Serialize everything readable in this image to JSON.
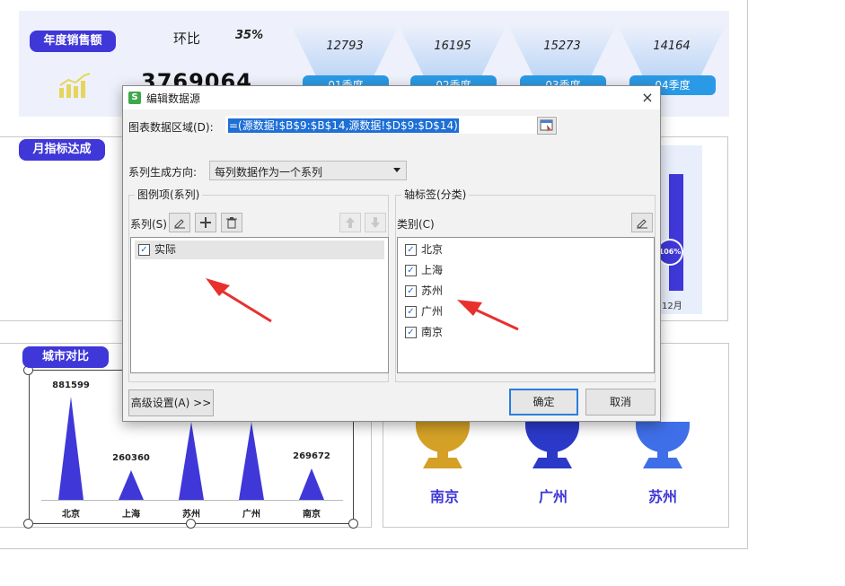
{
  "dashboard": {
    "annual_sales_title": "年度销售额",
    "mom_label": "环比",
    "mom_value": "35%",
    "annual_total": "3769064",
    "quarters": [
      {
        "value": "12793",
        "label": "01季度"
      },
      {
        "value": "16195",
        "label": "02季度"
      },
      {
        "value": "15273",
        "label": "03季度"
      },
      {
        "value": "14164",
        "label": "04季度"
      }
    ],
    "monthly_title": "月指标达成",
    "monthly_badge": "106%",
    "monthly_month": "12月",
    "city_compare_title": "城市对比",
    "city_chart": {
      "categories": [
        "北京",
        "上海",
        "苏州",
        "广州",
        "南京"
      ],
      "values": [
        "881599",
        "260360",
        "",
        "",
        "269672"
      ]
    },
    "ranking": [
      {
        "rank": "1",
        "city": "南京",
        "color": "#d4a126"
      },
      {
        "rank": "2",
        "city": "广州",
        "color": "#2b39c9"
      },
      {
        "rank": "3",
        "city": "苏州",
        "color": "#3f6fe8"
      }
    ]
  },
  "dialog": {
    "title": "编辑数据源",
    "app_icon": "S",
    "close_icon": "×",
    "range_label": "图表数据区域(D):",
    "range_value": "=(源数据!$B$9:$B$14,源数据!$D$9:$D$14)",
    "direction_label": "系列生成方向:",
    "direction_value": "每列数据作为一个系列",
    "legend_group": "图例项(系列)",
    "series_label": "系列(S)",
    "series": [
      {
        "label": "实际",
        "checked": true
      }
    ],
    "axis_group": "轴标签(分类)",
    "category_label": "类别(C)",
    "categories": [
      {
        "label": "北京",
        "checked": true
      },
      {
        "label": "上海",
        "checked": true
      },
      {
        "label": "苏州",
        "checked": true
      },
      {
        "label": "广州",
        "checked": true
      },
      {
        "label": "南京",
        "checked": true
      }
    ],
    "advanced_button": "高级设置(A) >>",
    "ok_button": "确定",
    "cancel_button": "取消"
  },
  "colors": {
    "accent": "#3f37d8",
    "selection": "#1e6fd6",
    "arrow": "#e8312c"
  }
}
